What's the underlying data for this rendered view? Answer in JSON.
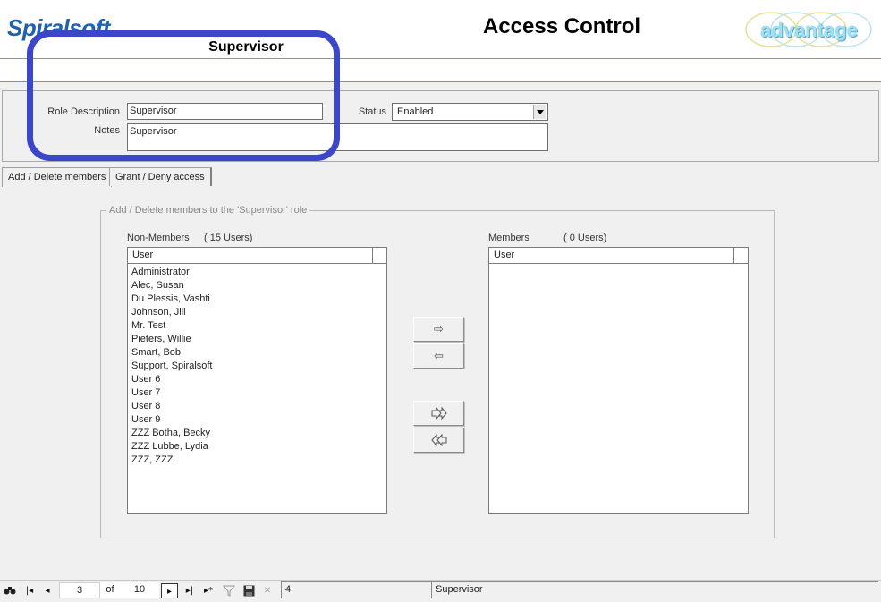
{
  "header": {
    "logo_text": "Spiralsoft",
    "role_name": "Supervisor",
    "title": "Access Control",
    "brand_text": "advantage"
  },
  "form": {
    "role_description_label": "Role Description",
    "role_description_value": "Supervisor",
    "status_label": "Status",
    "status_value": "Enabled",
    "notes_label": "Notes",
    "notes_value": "Supervisor"
  },
  "tabs": [
    {
      "label": "Add / Delete members",
      "active": true
    },
    {
      "label": "Grant / Deny access",
      "active": false
    }
  ],
  "members_panel": {
    "legend": "Add / Delete members to the 'Supervisor' role",
    "non_members_label": "Non-Members",
    "non_members_count": "( 15 Users)",
    "members_label": "Members",
    "members_count": "( 0 Users)",
    "column_header": "User",
    "non_members": [
      "Administrator",
      "Alec, Susan",
      "Du Plessis, Vashti",
      "Johnson, Jill",
      "Mr. Test",
      "Pieters, Willie",
      "Smart, Bob",
      "Support, Spiralsoft",
      "User 6",
      "User 7",
      "User 8",
      "User 9",
      "ZZZ Botha, Becky",
      "ZZZ Lubbe, Lydia",
      "ZZZ, ZZZ"
    ],
    "members": []
  },
  "transfer_buttons": {
    "add": "⇨",
    "remove": "⇦",
    "add_all": "⇨",
    "remove_all": "⇦"
  },
  "navigator": {
    "current": "3",
    "of_label": "of",
    "total": "10",
    "record_field": "4",
    "status_field": "Supervisor"
  },
  "colors": {
    "highlight": "#3c46c8",
    "logo": "#1f63b0",
    "header_rule": "#5d9fd3"
  }
}
